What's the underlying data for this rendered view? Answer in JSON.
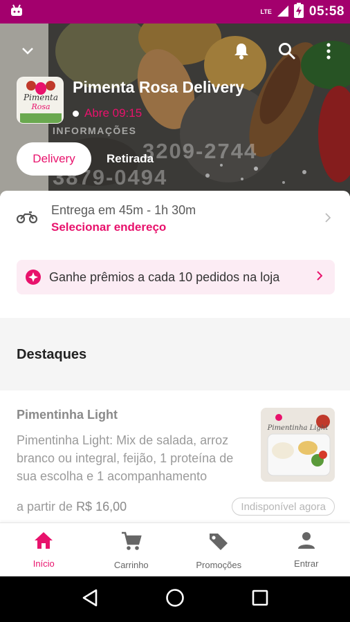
{
  "status_bar": {
    "time": "05:58",
    "network": "LTE"
  },
  "store": {
    "name": "Pimenta Rosa Delivery",
    "status": "Abre 09:15",
    "info_label": "INFORMAÇÕES",
    "phone_1": "3209-2744",
    "phone_2": "3879-0494",
    "logo_text_1": "Pimenta",
    "logo_text_2": "Rosa"
  },
  "mode_toggle": {
    "delivery": "Delivery",
    "pickup": "Retirada"
  },
  "delivery_info": {
    "eta": "Entrega em 45m - 1h 30m",
    "address_action": "Selecionar endereço"
  },
  "rewards": {
    "text": "Ganhe prêmios a cada 10 pedidos na loja"
  },
  "section": {
    "title": "Destaques"
  },
  "item": {
    "name": "Pimentinha Light",
    "description": "Pimentinha Light: Mix de salada, arroz branco ou integral, feijão, 1 proteína de sua escolha e 1 acompanhamento",
    "price_prefix": "a partir de",
    "price": "R$ 16,00",
    "availability": "Indisponível agora",
    "photo_label": "Pimentinha Light"
  },
  "bottom_nav": [
    {
      "label": "Início",
      "icon": "home-icon",
      "active": true
    },
    {
      "label": "Carrinho",
      "icon": "cart-icon",
      "active": false
    },
    {
      "label": "Promoções",
      "icon": "tag-icon",
      "active": false
    },
    {
      "label": "Entrar",
      "icon": "person-icon",
      "active": false
    }
  ],
  "colors": {
    "brand": "#e8126c",
    "status_bar": "#a3006d"
  }
}
